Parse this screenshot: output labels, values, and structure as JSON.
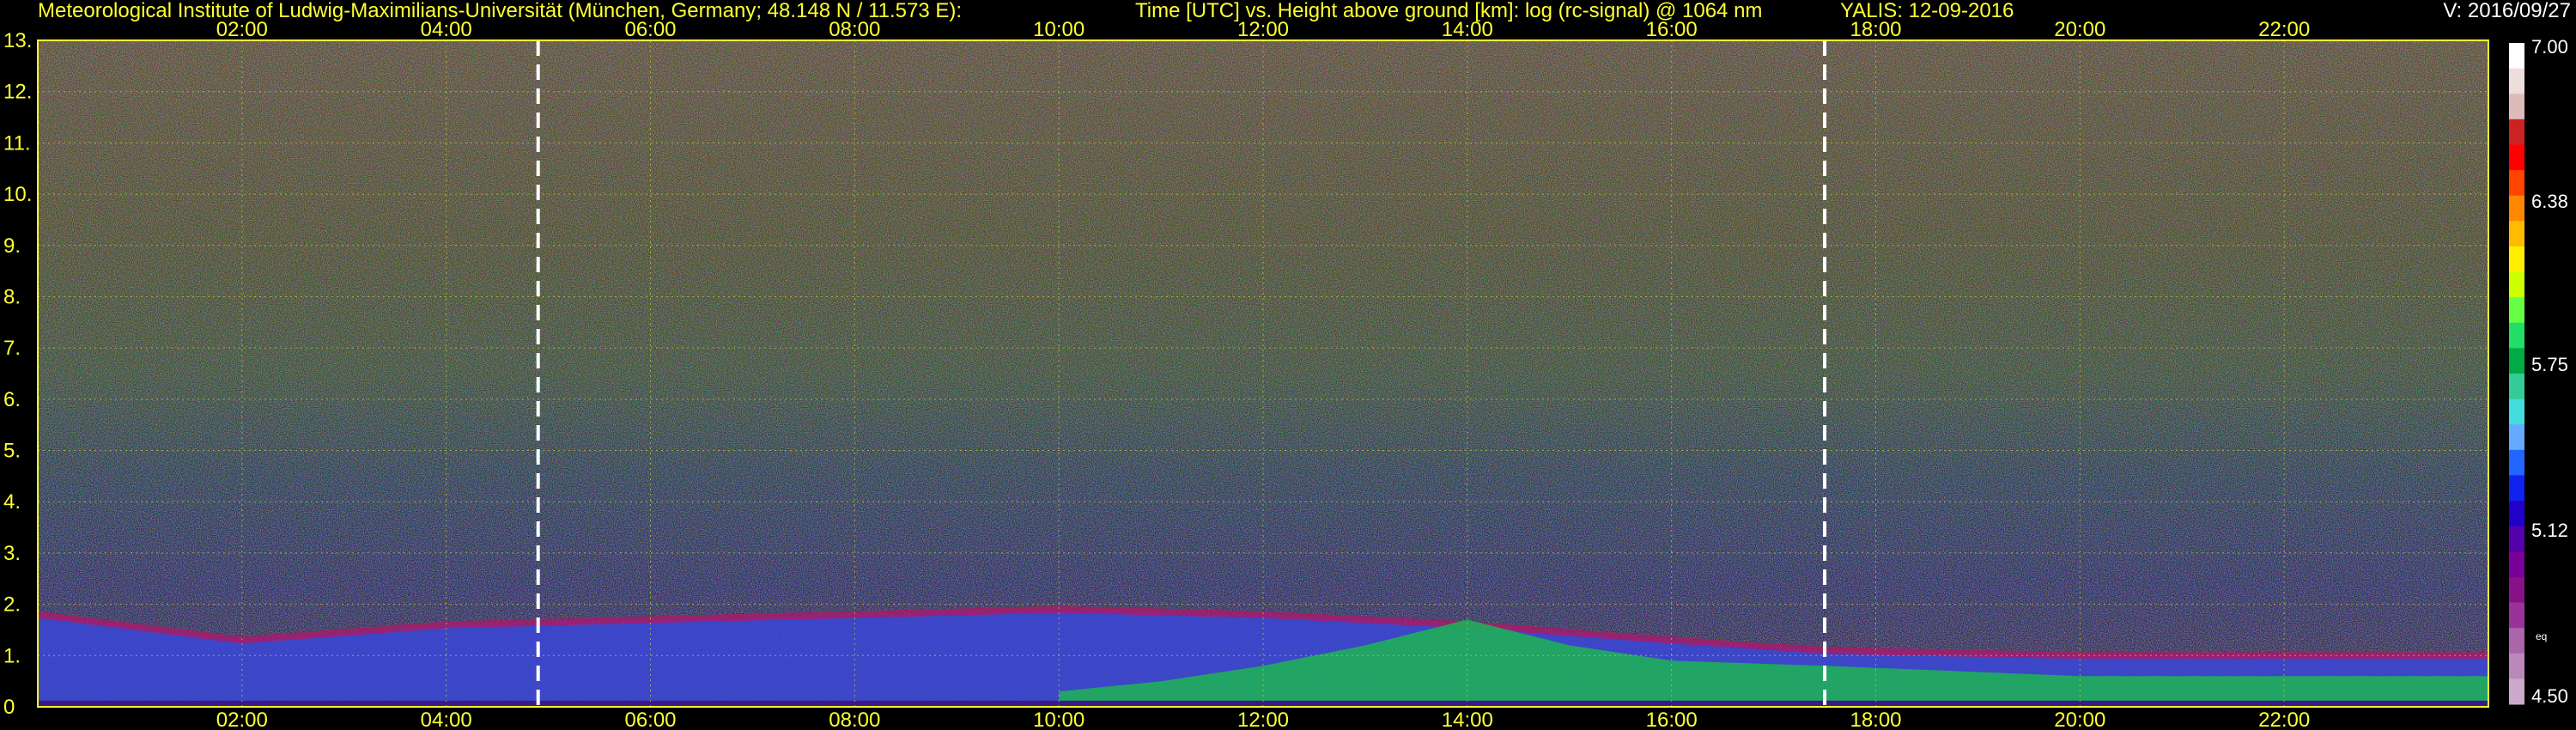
{
  "header": {
    "institute": "Meteorological Institute of Ludwig-Maximilians-Universität (München, Germany; 48.148 N / 11.573 E):",
    "description": "Time [UTC] vs. Height above ground [km]: log (rc-signal) @ 1064 nm",
    "site_date": "YALIS: 12-09-2016",
    "version": "V: 2016/09/27"
  },
  "chart_data": {
    "type": "heatmap",
    "xlabel": "Time [UTC]",
    "ylabel": "Height above ground [km]",
    "x_ticks": [
      "02:00",
      "04:00",
      "06:00",
      "08:00",
      "10:00",
      "12:00",
      "14:00",
      "16:00",
      "18:00",
      "20:00",
      "22:00"
    ],
    "x_range_hours": [
      0,
      24
    ],
    "y_ticks": [
      "0",
      "1.",
      "2.",
      "3.",
      "4.",
      "5.",
      "6.",
      "7.",
      "8.",
      "9.",
      "10.",
      "11.",
      "12.",
      "13."
    ],
    "y_range_km": [
      0,
      13
    ],
    "grid": true,
    "day_markers_hours": [
      4.9,
      17.5
    ],
    "colorbar": {
      "labels": [
        "7.00",
        "6.38",
        "5.75",
        "5.12",
        "4.50"
      ],
      "range": [
        4.5,
        7.0
      ],
      "unit_label": "eq",
      "colors": [
        "#ffffff",
        "#eedddd",
        "#ddbbbb",
        "#cc2222",
        "#ff0000",
        "#ff4400",
        "#ff8800",
        "#ffbb00",
        "#ffee00",
        "#ccff00",
        "#66ff44",
        "#22dd66",
        "#00aa44",
        "#33cc99",
        "#44dddd",
        "#66aaff",
        "#2266ff",
        "#1122ee",
        "#2200cc",
        "#5500aa",
        "#770099",
        "#881188",
        "#993399",
        "#aa66aa",
        "#bb88bb",
        "#ccaacc"
      ]
    },
    "boundary_layer_top_km": [
      {
        "time": 0.0,
        "height": 1.8
      },
      {
        "time": 2.0,
        "height": 1.3
      },
      {
        "time": 4.0,
        "height": 1.6
      },
      {
        "time": 6.0,
        "height": 1.7
      },
      {
        "time": 8.0,
        "height": 1.8
      },
      {
        "time": 10.0,
        "height": 1.9
      },
      {
        "time": 12.0,
        "height": 1.8
      },
      {
        "time": 14.0,
        "height": 1.6
      },
      {
        "time": 16.0,
        "height": 1.3
      },
      {
        "time": 17.5,
        "height": 1.1
      },
      {
        "time": 20.0,
        "height": 1.0
      },
      {
        "time": 24.0,
        "height": 1.0
      }
    ],
    "mixing_layer_top_km": [
      {
        "time": 10.0,
        "height": 0.3
      },
      {
        "time": 11.0,
        "height": 0.5
      },
      {
        "time": 12.0,
        "height": 0.8
      },
      {
        "time": 13.0,
        "height": 1.2
      },
      {
        "time": 14.0,
        "height": 1.7
      },
      {
        "time": 15.0,
        "height": 1.2
      },
      {
        "time": 16.0,
        "height": 0.9
      },
      {
        "time": 17.5,
        "height": 0.8
      },
      {
        "time": 20.0,
        "height": 0.6
      },
      {
        "time": 24.0,
        "height": 0.6
      }
    ]
  }
}
